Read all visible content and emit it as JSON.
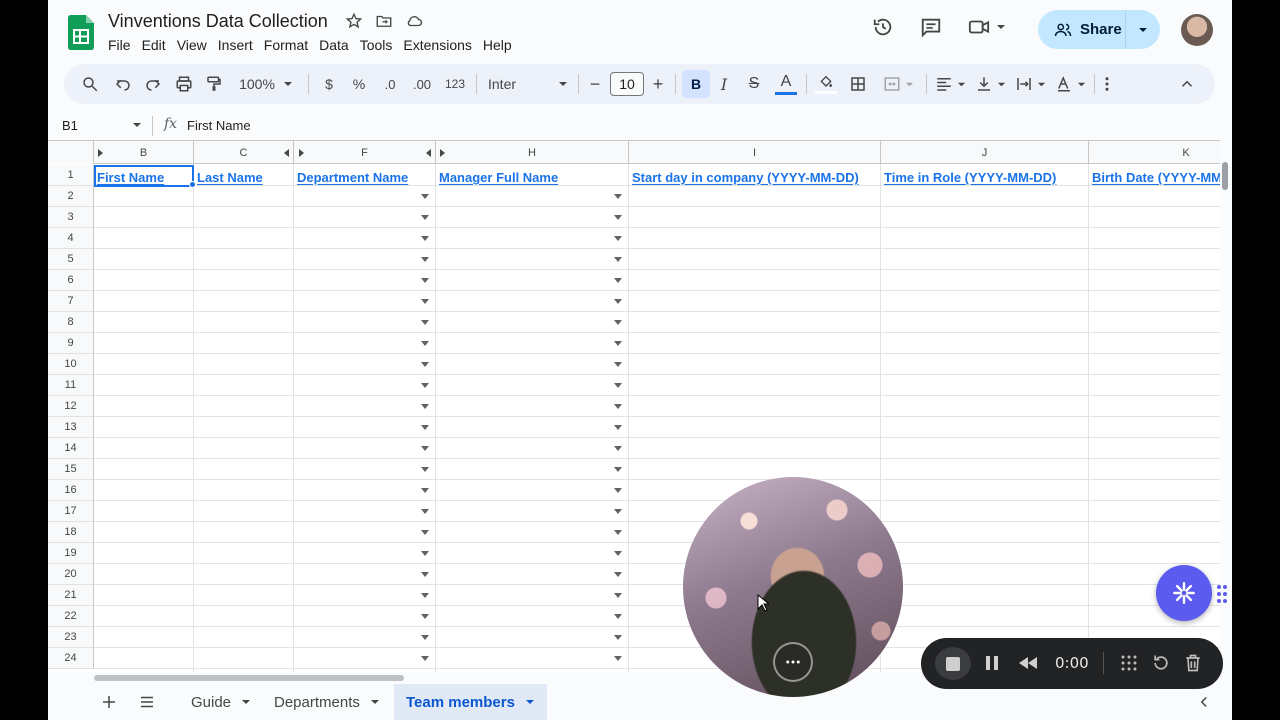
{
  "doc": {
    "title": "Vinventions Data Collection"
  },
  "menu": [
    "File",
    "Edit",
    "View",
    "Insert",
    "Format",
    "Data",
    "Tools",
    "Extensions",
    "Help"
  ],
  "share": {
    "label": "Share"
  },
  "toolbar": {
    "zoom": "100%",
    "currency": "$",
    "percent": "%",
    "dec_down": ".0",
    "dec_up": ".00",
    "number_format": "123",
    "font": "Inter",
    "font_size": "10",
    "bold": "B",
    "italic": "I",
    "strike": "S",
    "text_color": "A"
  },
  "formula_bar": {
    "cell_ref": "B1",
    "fx": "fx",
    "content": "First Name"
  },
  "columns": [
    {
      "letter": "B",
      "header": "First Name"
    },
    {
      "letter": "C",
      "header": "Last Name"
    },
    {
      "letter": "F",
      "header": "Department Name"
    },
    {
      "letter": "H",
      "header": "Manager Full Name"
    },
    {
      "letter": "I",
      "header": "Start day in company (YYYY-MM-DD)"
    },
    {
      "letter": "J",
      "header": "Time in Role (YYYY-MM-DD)"
    },
    {
      "letter": "K",
      "header": "Birth Date (YYYY-MM-DD)"
    }
  ],
  "rows": [
    "1",
    "2",
    "3",
    "4",
    "5",
    "6",
    "7",
    "8",
    "9",
    "10",
    "11",
    "12",
    "13",
    "14",
    "15",
    "16",
    "17",
    "18",
    "19",
    "20",
    "21",
    "22",
    "23",
    "24"
  ],
  "sheets": [
    {
      "label": "Guide",
      "active": false
    },
    {
      "label": "Departments",
      "active": false
    },
    {
      "label": "Team members",
      "active": true
    }
  ],
  "recorder": {
    "time": "0:00"
  },
  "colors": {
    "accent": "#1a73e8",
    "share_bg": "#c2e7ff",
    "ai_button": "#5b5bf0"
  }
}
